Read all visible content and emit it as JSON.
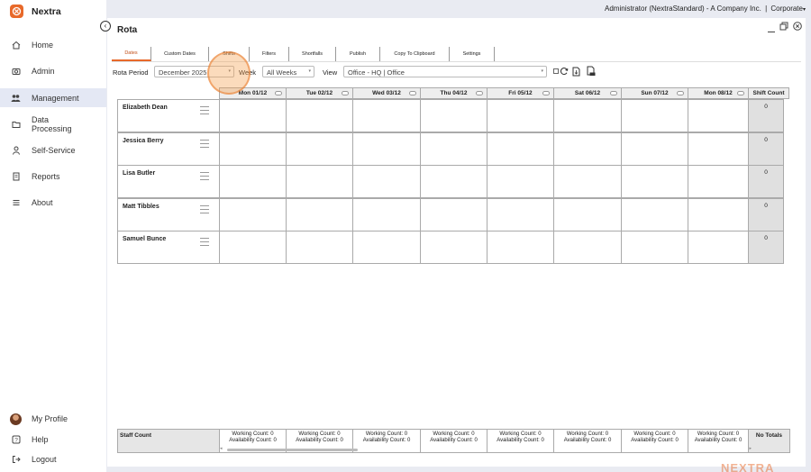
{
  "app": {
    "name": "Nextra",
    "brand_color": "#e8692a",
    "watermark": "NEXTRA"
  },
  "userbar": {
    "user": "Administrator (NextraStandard) - A Company Inc.",
    "separator": "|",
    "context": "Corporate"
  },
  "sidebar": {
    "items": [
      {
        "label": "Home",
        "icon": "home-icon"
      },
      {
        "label": "Admin",
        "icon": "camera-icon"
      },
      {
        "label": "Management",
        "icon": "people-icon",
        "active": true
      },
      {
        "label": "Data\nProcessing",
        "icon": "folder-icon"
      },
      {
        "label": "Self-Service",
        "icon": "person-icon"
      },
      {
        "label": "Reports",
        "icon": "report-icon"
      },
      {
        "label": "About",
        "icon": "menu-icon"
      }
    ],
    "bottom": [
      {
        "label": "My Profile",
        "icon": "avatar"
      },
      {
        "label": "Help",
        "icon": "help-icon"
      },
      {
        "label": "Logout",
        "icon": "logout-icon"
      }
    ]
  },
  "page": {
    "title": "Rota"
  },
  "tabs": [
    "Dates",
    "Custom Dates",
    "Shifts",
    "Filters",
    "Shortfalls",
    "Publish",
    "Copy To Clipboard",
    "Settings"
  ],
  "active_tab": "Dates",
  "filters": {
    "rota_period_label": "Rota Period",
    "rota_period_value": "December 2025",
    "week_label": "Week",
    "week_value": "All Weeks",
    "view_label": "View",
    "view_value": "Office - HQ | Office"
  },
  "grid": {
    "days": [
      "Mon 01/12",
      "Tue 02/12",
      "Wed 03/12",
      "Thu 04/12",
      "Fri 05/12",
      "Sat 06/12",
      "Sun 07/12",
      "Mon 08/12"
    ],
    "shift_count_header": "Shift Count",
    "staff": [
      {
        "name": "Elizabeth Dean",
        "shift_count": "0"
      },
      {
        "name": "Jessica Berry",
        "shift_count": "0"
      },
      {
        "name": "Lisa Butler",
        "shift_count": "0"
      },
      {
        "name": "Matt Tibbles",
        "shift_count": "0"
      },
      {
        "name": "Samuel Bunce",
        "shift_count": "0"
      }
    ]
  },
  "footer": {
    "staff_count_label": "Staff Count",
    "working": "Working Count: 0",
    "availability": "Availability Count: 0",
    "totals": "No Totals"
  }
}
